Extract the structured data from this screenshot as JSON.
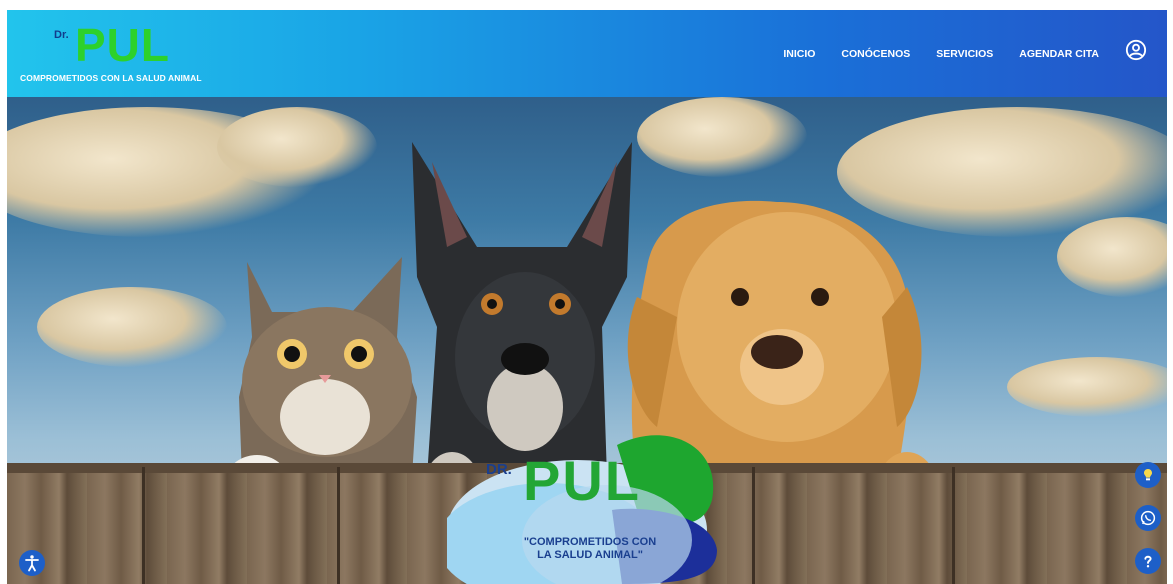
{
  "brand": {
    "prefix": "Dr.",
    "name": "PUL",
    "tagline": "COMPROMETIDOS CON LA SALUD ANIMAL"
  },
  "nav": {
    "items": [
      "INICIO",
      "CONÓCENOS",
      "SERVICIOS",
      "AGENDAR CITA"
    ],
    "user_icon": "user-circle-icon"
  },
  "hero": {
    "image_subject": "cat, dog and golden retriever peeking over wooden fence",
    "logo": {
      "prefix": "DR.",
      "name": "PUL",
      "tagline": "\"COMPROMETIDOS CON\nLA SALUD ANIMAL\""
    }
  },
  "floating_buttons": {
    "accessibility": "accessibility-icon",
    "tips": "lightbulb-icon",
    "whatsapp": "whatsapp-icon",
    "help": "help-icon"
  },
  "colors": {
    "header_start": "#22c4ec",
    "header_end": "#2456c9",
    "brand_green": "#2dd12c",
    "brand_blue": "#123c8c",
    "button_blue": "#1d5fc8"
  }
}
